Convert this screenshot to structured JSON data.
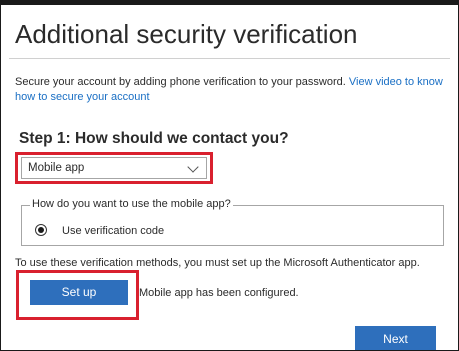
{
  "page": {
    "title": "Additional security verification",
    "intro_text": "Secure your account by adding phone verification to your password. ",
    "intro_link": "View video to know how to secure your account"
  },
  "step1": {
    "heading": "Step 1: How should we contact you?",
    "contact_method": {
      "selected": "Mobile app"
    },
    "mobile_app_usage": {
      "legend": "How do you want to use the mobile app?",
      "option_label": "Use verification code",
      "option_selected": true
    },
    "info_text": "To use these verification methods, you must set up the Microsoft Authenticator app.",
    "setup_label": "Set up",
    "setup_status": "Mobile app has been configured."
  },
  "footer": {
    "next_label": "Next"
  },
  "colors": {
    "button_blue": "#2e6fbc",
    "link_blue": "#1a6fc4",
    "highlight_red": "#d9202e"
  }
}
